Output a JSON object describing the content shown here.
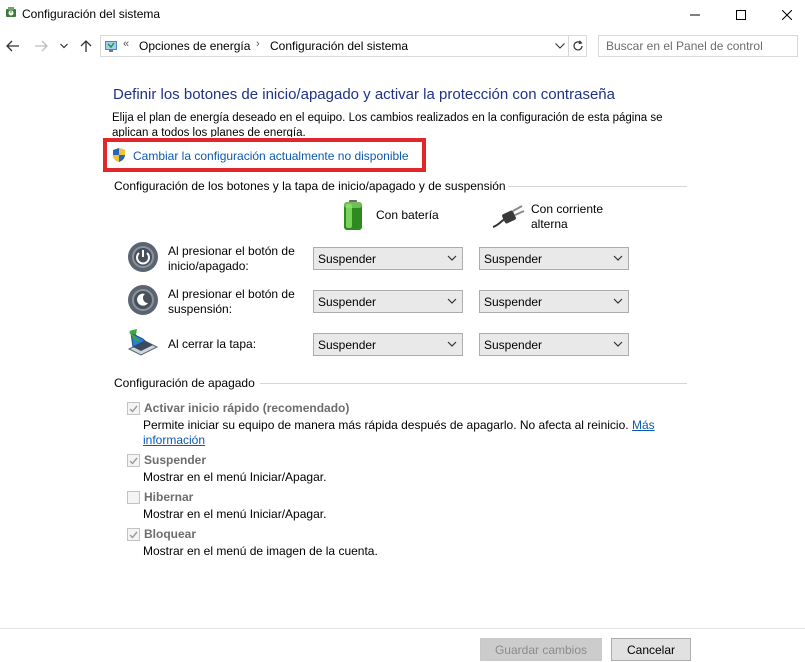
{
  "window": {
    "title": "Configuración del sistema"
  },
  "address": {
    "crumb_overflow": "«",
    "crumbs": [
      "Opciones de energía",
      "Configuración del sistema"
    ],
    "separator": "›",
    "search_placeholder": "Buscar en el Panel de control"
  },
  "main": {
    "heading": "Definir los botones de inicio/apagado y activar la protección con contraseña",
    "intro": "Elija el plan de energía deseado en el equipo. Los cambios realizados en la configuración de esta página se aplican a todos los planes de energía.",
    "change_link": "Cambiar la configuración actualmente no disponible",
    "highlight_color": "#e2272b",
    "link_color": "#0b59b2",
    "heading_color": "#1e3287"
  },
  "buttons_section": {
    "title": "Configuración de los botones y la tapa de inicio/apagado y de suspensión",
    "col_battery": "Con batería",
    "col_ac_line1": "Con corriente",
    "col_ac_line2": "alterna",
    "battery_icon": "battery-icon",
    "plug_icon": "power-plug-icon",
    "rows": [
      {
        "label_line1": "Al presionar el botón de",
        "label_line2": "inicio/apagado:",
        "icon": "power-button-icon",
        "battery": "Suspender",
        "ac": "Suspender"
      },
      {
        "label_line1": "Al presionar el botón de",
        "label_line2": "suspensión:",
        "icon": "sleep-button-icon",
        "battery": "Suspender",
        "ac": "Suspender"
      },
      {
        "label_line1": "Al cerrar la tapa:",
        "label_line2": "",
        "icon": "laptop-lid-icon",
        "battery": "Suspender",
        "ac": "Suspender"
      }
    ]
  },
  "shutdown_section": {
    "title": "Configuración de apagado",
    "options": [
      {
        "label": "Activar inicio rápido (recomendado)",
        "checked": true,
        "desc": "Permite iniciar su equipo de manera más rápida después de apagarlo. No afecta al reinicio.",
        "link_part1": "Más",
        "link_part2": "información"
      },
      {
        "label": "Suspender",
        "checked": true,
        "desc": "Mostrar en el menú Iniciar/Apagar."
      },
      {
        "label": "Hibernar",
        "checked": false,
        "desc": "Mostrar en el menú Iniciar/Apagar."
      },
      {
        "label": "Bloquear",
        "checked": true,
        "desc": "Mostrar en el menú de imagen de la cuenta."
      }
    ]
  },
  "footer": {
    "save": "Guardar cambios",
    "cancel": "Cancelar"
  }
}
